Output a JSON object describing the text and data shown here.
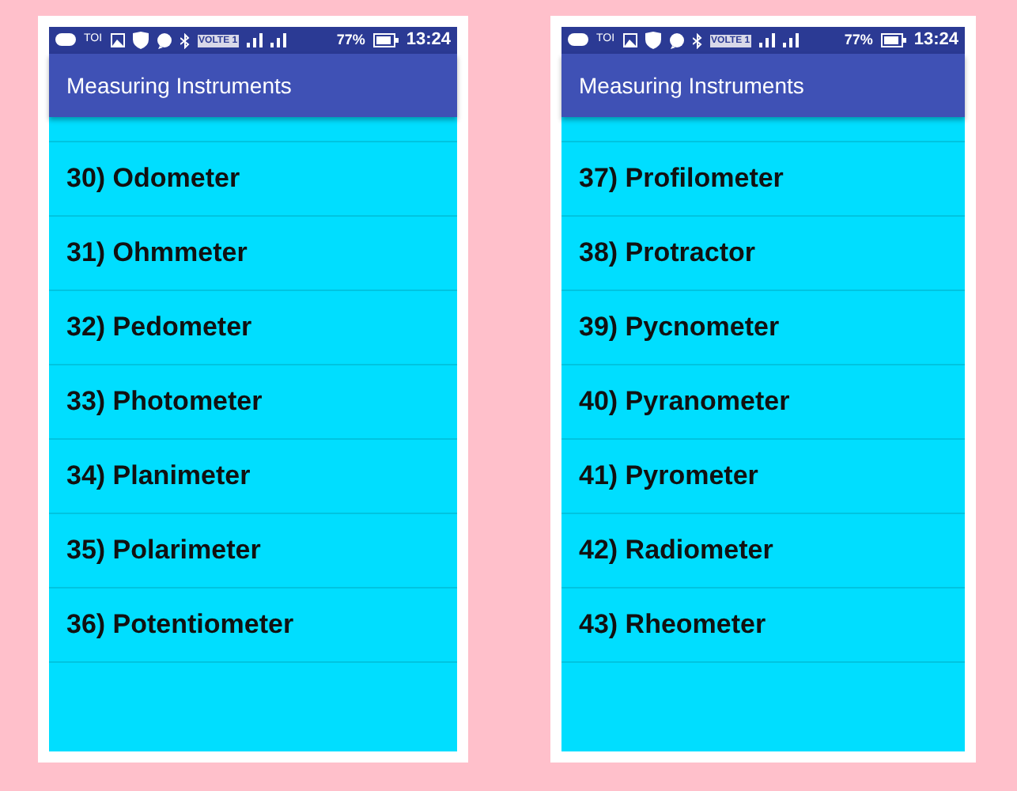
{
  "phones": [
    {
      "status_bar": {
        "carrier": "TOI",
        "network": "VOLTE 1",
        "battery": "77%",
        "time": "13:24"
      },
      "app_bar": {
        "title": "Measuring Instruments"
      },
      "items": [
        "30) Odometer",
        "31) Ohmmeter",
        "32) Pedometer",
        "33) Photometer",
        "34) Planimeter",
        "35) Polarimeter",
        "36) Potentiometer"
      ]
    },
    {
      "status_bar": {
        "carrier": "TOI",
        "network": "VOLTE 1",
        "battery": "77%",
        "time": "13:24"
      },
      "app_bar": {
        "title": "Measuring Instruments"
      },
      "items": [
        "37) Profilometer",
        "38) Protractor",
        "39) Pycnometer",
        "40) Pyranometer",
        "41) Pyrometer",
        "42) Radiometer",
        "43) Rheometer"
      ]
    }
  ]
}
